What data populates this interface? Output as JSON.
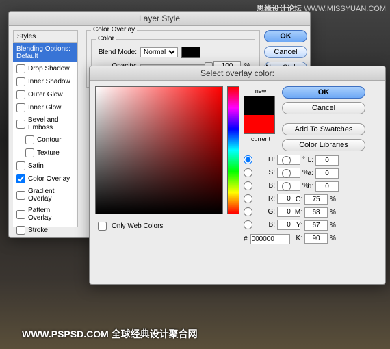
{
  "watermark": {
    "top_label": "思缘设计论坛",
    "top_url": "WWW.MISSYUAN.COM",
    "bottom": "WWW.PSPSD.COM 全球经典设计聚合网"
  },
  "layerStyle": {
    "title": "Layer Style",
    "stylesHeader": "Styles",
    "blendingDefault": "Blending Options: Default",
    "items": [
      "Drop Shadow",
      "Inner Shadow",
      "Outer Glow",
      "Inner Glow",
      "Bevel and Emboss",
      "Contour",
      "Texture",
      "Satin",
      "Color Overlay",
      "Gradient Overlay",
      "Pattern Overlay",
      "Stroke"
    ],
    "groupLabel": "Color Overlay",
    "colorLabel": "Color",
    "blendModeLabel": "Blend Mode:",
    "blendModeValue": "Normal",
    "opacityLabel": "Opacity:",
    "opacityValue": "100",
    "pct": "%",
    "buttons": {
      "ok": "OK",
      "cancel": "Cancel",
      "newStyle": "New Style..."
    }
  },
  "colorPicker": {
    "title": "Select overlay color:",
    "newLabel": "new",
    "currentLabel": "current",
    "buttons": {
      "ok": "OK",
      "cancel": "Cancel",
      "add": "Add To Swatches",
      "libs": "Color Libraries"
    },
    "onlyWeb": "Only Web Colors",
    "hashLabel": "#",
    "hexValue": "000000",
    "hsb": {
      "H": "0",
      "S": "0",
      "B": "0"
    },
    "lab": {
      "L": "0",
      "a": "0",
      "b": "0"
    },
    "rgb": {
      "R": "0",
      "G": "0",
      "B": "0"
    },
    "cmyk": {
      "C": "75",
      "M": "68",
      "Y": "67",
      "K": "90"
    },
    "deg": "°",
    "pct": "%"
  }
}
